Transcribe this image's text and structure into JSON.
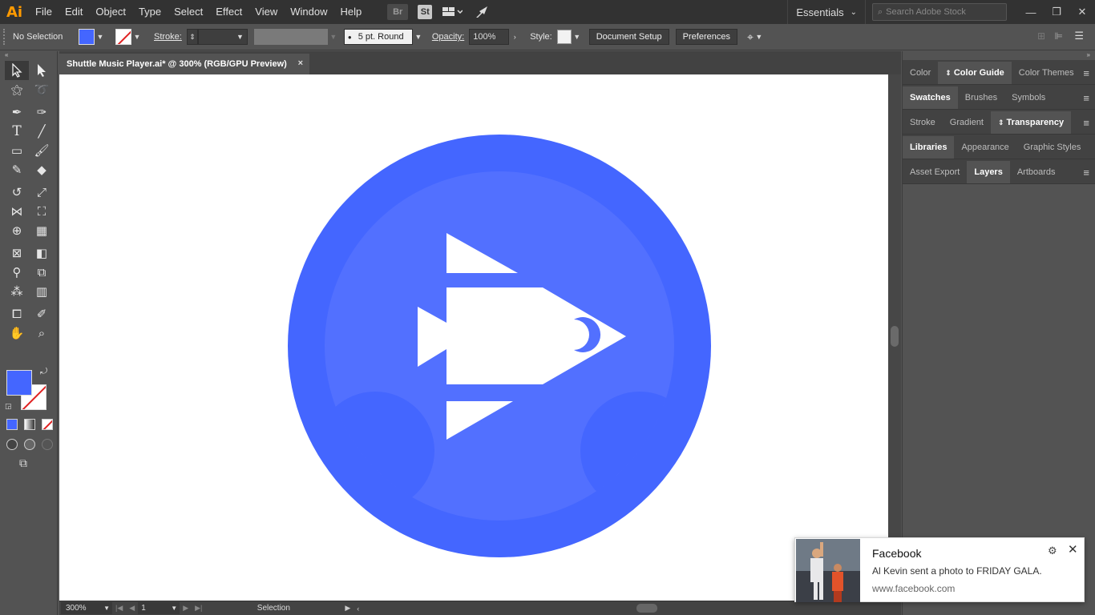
{
  "app": {
    "logo": "Ai"
  },
  "menu": [
    "File",
    "Edit",
    "Object",
    "Type",
    "Select",
    "Effect",
    "View",
    "Window",
    "Help"
  ],
  "menubar_icons": {
    "bridge": "Br",
    "stock": "St"
  },
  "workspace": "Essentials",
  "search_placeholder": "Search Adobe Stock",
  "window_controls": {
    "minimize": "—",
    "restore": "❐",
    "close": "✕"
  },
  "control": {
    "selection": "No Selection",
    "stroke_label": "Stroke:",
    "brush": "5 pt. Round",
    "opacity_label": "Opacity:",
    "opacity_value": "100%",
    "style_label": "Style:",
    "document_setup": "Document Setup",
    "preferences": "Preferences"
  },
  "document": {
    "tab_title": "Shuttle Music Player.ai* @ 300% (RGB/GPU Preview)",
    "close": "×"
  },
  "colors": {
    "outer_circle": "#4466ff",
    "inner_circle": "#5270ff",
    "fill": "#4466ff",
    "canvas": "#ffffff"
  },
  "status": {
    "zoom": "300%",
    "page": "1",
    "tool": "Selection"
  },
  "panels": {
    "row1": [
      "Color",
      "Color Guide",
      "Color Themes"
    ],
    "row2": [
      "Swatches",
      "Brushes",
      "Symbols"
    ],
    "row3": [
      "Stroke",
      "Gradient",
      "Transparency"
    ],
    "row4": [
      "Libraries",
      "Appearance",
      "Graphic Styles"
    ],
    "row5": [
      "Asset Export",
      "Layers",
      "Artboards"
    ]
  },
  "notification": {
    "app": "Facebook",
    "message": "Al Kevin sent a photo to FRIDAY GALA.",
    "url": "www.facebook.com"
  }
}
